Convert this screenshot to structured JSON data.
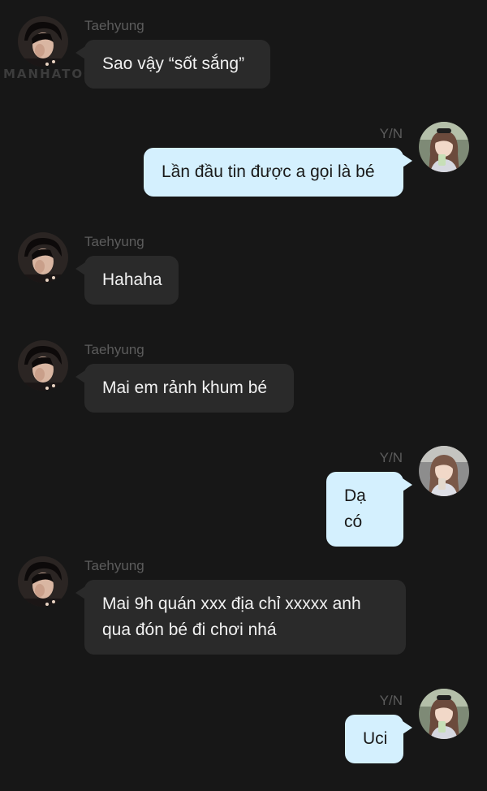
{
  "watermark": "MANHATOON",
  "colors": {
    "background": "#171717",
    "incoming_bubble": "#2a2a2a",
    "outgoing_bubble": "#d4f0fe",
    "sender_name": "#5c5c5c"
  },
  "messages": [
    {
      "sender": "Taehyung",
      "text": "Sao vậy “sốt sắng”",
      "direction": "incoming",
      "avatar": "taehyung-avatar"
    },
    {
      "sender": "Y/N",
      "text": "Lần đầu tin được a gọi là bé",
      "direction": "outgoing",
      "avatar": "yn-avatar"
    },
    {
      "sender": "Taehyung",
      "text": "Hahaha",
      "direction": "incoming",
      "avatar": "taehyung-avatar"
    },
    {
      "sender": "Taehyung",
      "text": "Mai em rảnh khum bé",
      "direction": "incoming",
      "avatar": "taehyung-avatar"
    },
    {
      "sender": "Y/N",
      "text": "Dạ có",
      "direction": "outgoing",
      "avatar": "yn-avatar"
    },
    {
      "sender": "Taehyung",
      "text": "Mai 9h quán xxx địa chỉ xxxxx anh qua đón bé đi chơi nhá",
      "direction": "incoming",
      "avatar": "taehyung-avatar"
    },
    {
      "sender": "Y/N",
      "text": "Uci",
      "direction": "outgoing",
      "avatar": "yn-avatar"
    }
  ]
}
